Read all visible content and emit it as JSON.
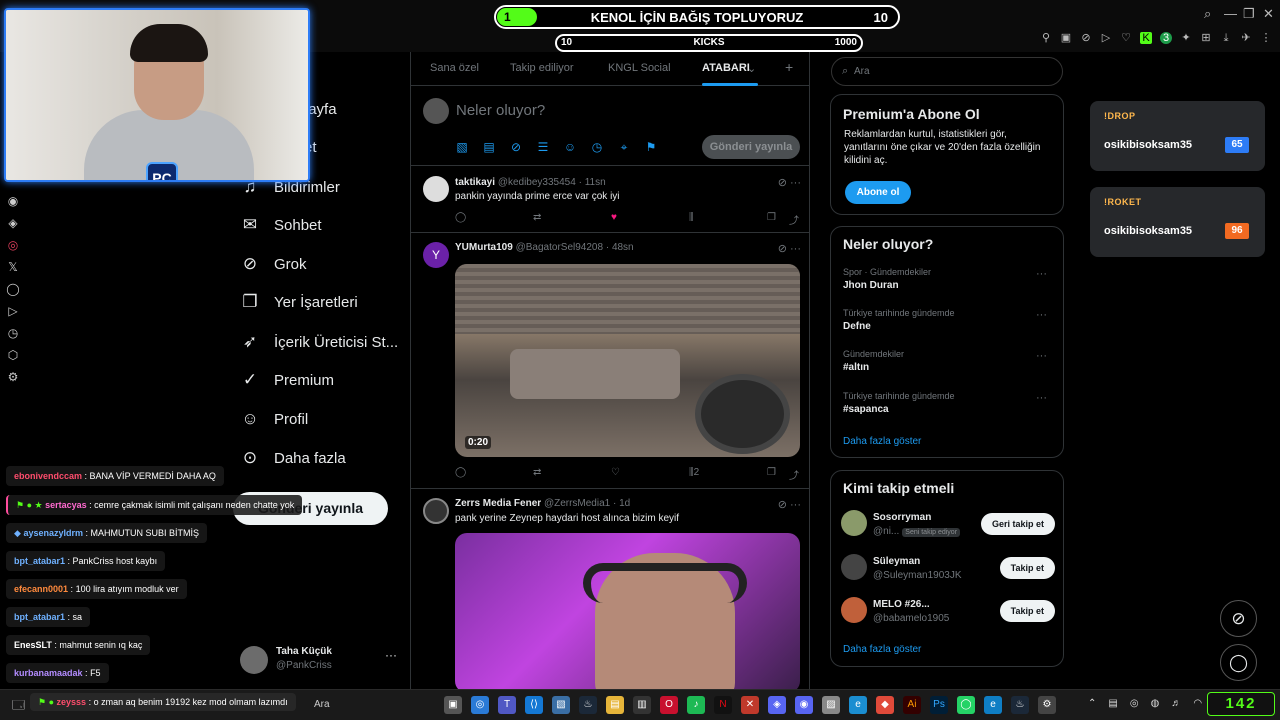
{
  "overlay": {
    "donation": {
      "title": "KENOL İÇİN BAĞIŞ TOPLUYORUZ",
      "left_value": "1",
      "right_value": "10",
      "progress": 0.1
    },
    "kicks": {
      "label": "KICKS",
      "left_value": "10",
      "right_value": "1000"
    },
    "kick_counter": "142",
    "webcam_logo": "PC"
  },
  "nav": {
    "items": [
      {
        "label": "Anasayfa",
        "icon": "home-icon"
      },
      {
        "label": "Keşfet",
        "icon": "search-icon"
      },
      {
        "label": "Bildirimler",
        "icon": "bell-icon"
      },
      {
        "label": "Sohbet",
        "icon": "chat-icon"
      },
      {
        "label": "Grok",
        "icon": "grok-icon"
      },
      {
        "label": "Yer İşaretleri",
        "icon": "bookmark-icon"
      },
      {
        "label": "İçerik Üreticisi St...",
        "icon": "rocket-icon"
      },
      {
        "label": "Premium",
        "icon": "verified-icon"
      },
      {
        "label": "Profil",
        "icon": "user-icon"
      },
      {
        "label": "Daha fazla",
        "icon": "more-icon"
      }
    ],
    "post_button": "Gönderi yayınla",
    "profile": {
      "name": "Taha Küçük",
      "handle": "@PankCriss"
    }
  },
  "timeline": {
    "tabs": [
      "Sana özel",
      "Takip ediliyor",
      "KNGL Social",
      "ATABARI"
    ],
    "active_tab": "ATABARI",
    "compose_placeholder": "Neler oluyor?",
    "compose_button": "Gönderi yayınla",
    "tweets": [
      {
        "name": "taktikayi",
        "handle": "@kedibey335454",
        "time": "11sn",
        "text": "pankin yayında prime erce var çok iyi",
        "views": ""
      },
      {
        "name": "YUMurta109",
        "handle": "@BagatorSel94208",
        "time": "48sn",
        "text": "",
        "video_duration": "0:20",
        "views": "2"
      },
      {
        "name": "Zerrs Media Fener",
        "handle": "@ZerrsMedia1",
        "time": "1d",
        "text": "pank yerine Zeynep haydari host alınca bizim keyif"
      }
    ]
  },
  "right": {
    "search_placeholder": "Ara",
    "premium": {
      "title": "Premium'a Abone Ol",
      "text_lines": [
        "Reklamlardan kurtul, istatistikleri gör,",
        "yanıtlarını öne çıkar ve 20'den fazla özelliğin",
        "kilidini aç."
      ],
      "button": "Abone ol"
    },
    "trends": {
      "title": "Neler oluyor?",
      "items": [
        {
          "context": "Spor · Gündemdekiler",
          "name": "Jhon Duran"
        },
        {
          "context": "Türkiye tarihinde gündemde",
          "name": "Defne"
        },
        {
          "context": "Gündemdekiler",
          "name": "#altın"
        },
        {
          "context": "Türkiye tarihinde gündemde",
          "name": "#sapanca"
        }
      ],
      "more": "Daha fazla göster"
    },
    "who_to_follow": {
      "title": "Kimi takip etmeli",
      "items": [
        {
          "name": "Sosorryman",
          "handle": "@ni...",
          "badge": "Seni takip ediyor",
          "button": "Geri takip et"
        },
        {
          "name": "Süleyman",
          "handle": "@Suleyman1903JK",
          "button": "Takip et"
        },
        {
          "name": "MELO #26...",
          "handle": "@babamelo1905",
          "button": "Takip et"
        }
      ],
      "more": "Daha fazla göster"
    }
  },
  "widgets": [
    {
      "title": "!DROP",
      "name": "osikibisoksam35",
      "value": "65",
      "color": "#2d7cf6"
    },
    {
      "title": "!ROKET",
      "name": "osikibisoksam35",
      "value": "96",
      "color": "#f26a21"
    }
  ],
  "chat": [
    {
      "user": "ebonivendccam",
      "color": "#ff4d6d",
      "text": "BANA VİP VERMEDİ DAHA AQ"
    },
    {
      "user": "sertacyas",
      "color": "#ff6bd0",
      "text": "cemre çakmak isimli mit çalışanı neden chatte yok"
    },
    {
      "user": "aysenazyldrm",
      "color": "#6fb1ff",
      "text": "MAHMUTUN SUBI BİTMİŞ"
    },
    {
      "user": "bpt_atabar1",
      "color": "#6fb1ff",
      "text": "PankCriss host kaybı"
    },
    {
      "user": "efecann0001",
      "color": "#ff8a3d",
      "text": "100 lira atıyım modluk ver"
    },
    {
      "user": "bpt_atabar1",
      "color": "#6fb1ff",
      "text": "sa"
    },
    {
      "user": "EnesSLT",
      "color": "#ffffff",
      "text": "mahmut senin ıq kaç"
    },
    {
      "user": "kurbanamaadak",
      "color": "#b38cff",
      "text": "F5"
    },
    {
      "user": "zeysss",
      "color": "#ff4d6d",
      "text": "o zman aq benim 19192 kez mod olmam lazımdı"
    }
  ],
  "taskbar": {
    "search": "Ara"
  }
}
